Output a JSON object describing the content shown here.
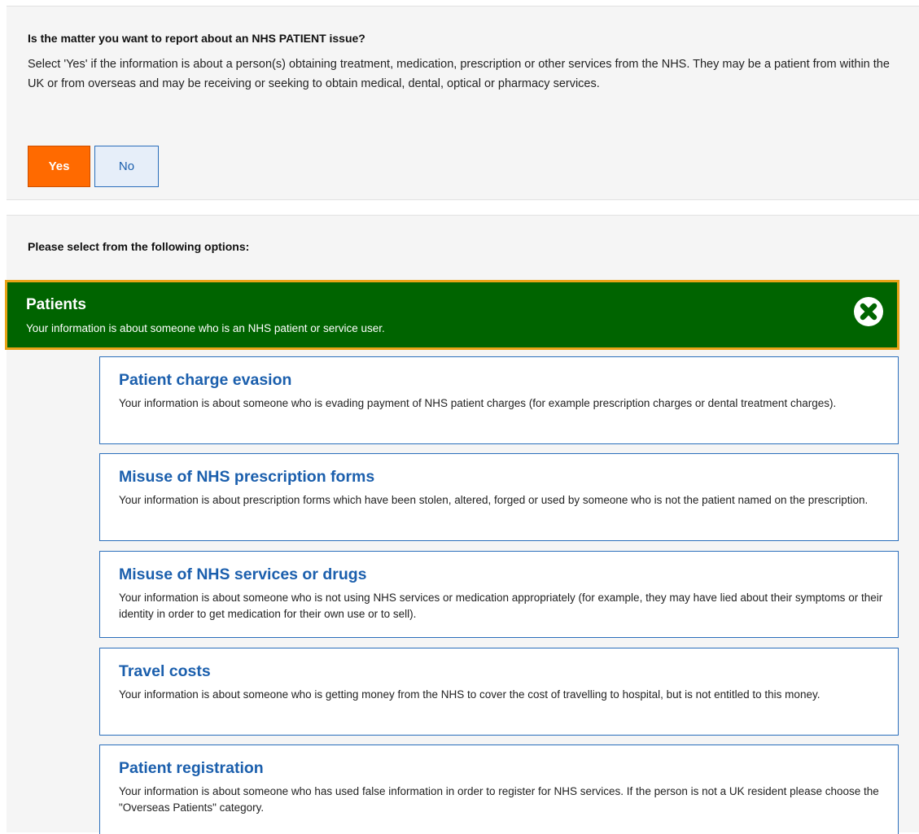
{
  "question": {
    "title": "Is the matter you want to report about an NHS PATIENT issue?",
    "description": "Select 'Yes' if the information is about a person(s) obtaining treatment, medication, prescription or other services from the NHS. They may be a patient from within the UK or from overseas and may be receiving or seeking to obtain medical, dental, optical or pharmacy services.",
    "yes_label": "Yes",
    "no_label": "No",
    "selected": "Yes"
  },
  "options": {
    "title": "Please select from the following options:",
    "category": {
      "name": "Patients",
      "description": "Your information is about someone who is an NHS patient or service user.",
      "close_icon": "close-circle-icon"
    },
    "items": [
      {
        "title": "Patient charge evasion",
        "description": "Your information is about someone who is evading payment of NHS patient charges (for example prescription charges or dental treatment charges)."
      },
      {
        "title": "Misuse of NHS prescription forms",
        "description": "Your information is about prescription forms which have been stolen, altered, forged or used by someone who is not the patient named on the prescription."
      },
      {
        "title": "Misuse of NHS services or drugs",
        "description": "Your information is about someone who is not using NHS services or medication appropriately (for example, they may have lied about their symptoms or their identity in order to get medication for their own use or to sell)."
      },
      {
        "title": "Travel costs",
        "description": "Your information is about someone who is getting money from the NHS to cover the cost of travelling to hospital, but is not entitled to this money."
      },
      {
        "title": "Patient registration",
        "description": "Your information is about someone who has used false information in order to register for NHS services. If the person is not a UK resident please choose the \"Overseas Patients\" category."
      }
    ]
  },
  "colors": {
    "accent_orange": "#ff6a00",
    "link_blue": "#1b5fad",
    "category_green": "#006400",
    "category_border": "#e8a317",
    "panel_bg": "#f5f5f5"
  }
}
